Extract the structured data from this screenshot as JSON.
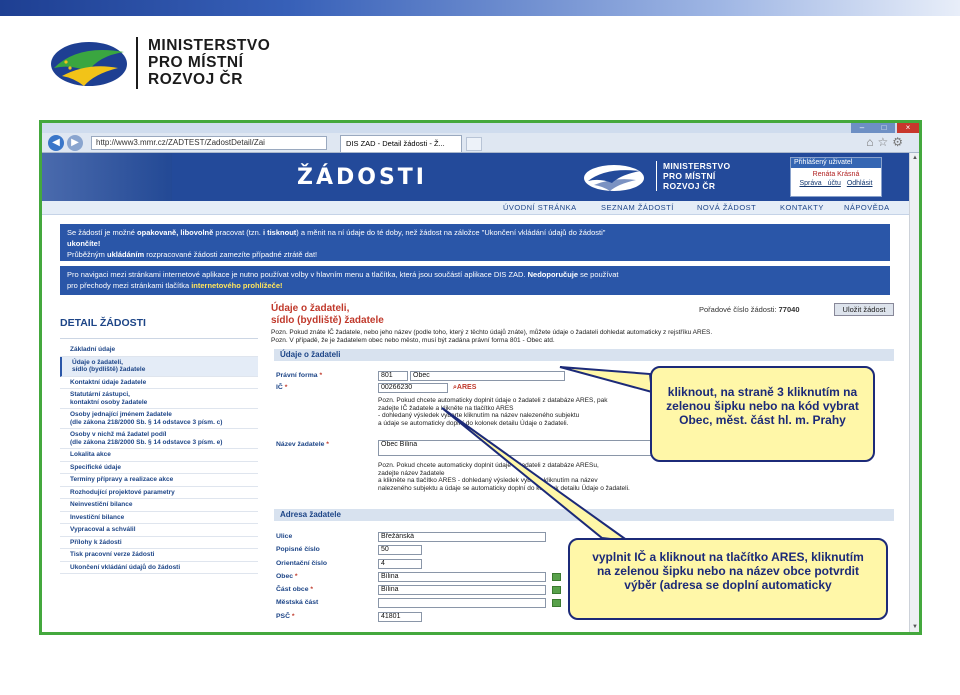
{
  "slide": {
    "ministry_lines": [
      "MINISTERSTVO",
      "PRO MÍSTNÍ",
      "ROZVOJ ČR"
    ],
    "brand_colors": {
      "blue": "#1e3f92",
      "green": "#3aa640",
      "yellow": "#f2c318",
      "frame": "#44a83d"
    }
  },
  "browser": {
    "url": "http://www3.mmr.cz/ZADTEST/ZadostDetail/Zai",
    "tab_title": "DIS ZAD - Detail žádosti - Ž..."
  },
  "header": {
    "title": "ŽÁDOSTI",
    "ministry_lines": [
      "MINISTERSTVO",
      "PRO MÍSTNÍ",
      "ROZVOJ ČR"
    ],
    "user": {
      "heading": "Přihlášený uživatel",
      "name": "Renáta Krásná",
      "link_account": "Správa účtu",
      "link_logout": "Odhlásit"
    }
  },
  "menu": [
    "ÚVODNÍ STRÁNKA",
    "SEZNAM ŽÁDOSTÍ",
    "NOVÁ ŽÁDOST",
    "KONTAKTY",
    "NÁPOVĚDA"
  ],
  "info1": {
    "l1a": "Se žádostí je možné ",
    "l1b": "opakovaně, libovolně",
    "l1c": " pracovat (tzn. ",
    "l1d": "i tisknout",
    "l1e": ") a měnit na ní údaje do té doby, než žádost na záložce \"Ukončení vkládání údajů do žádosti\"",
    "l2": "ukončíte!",
    "l3a": "Průběžným ",
    "l3b": "ukládáním",
    "l3c": " rozpracované žádosti zamezíte případné ztrátě dat!"
  },
  "info2": {
    "l1a": "Pro navigaci mezi stránkami internetové aplikace je nutno používat volby v hlavním menu a tlačítka, která jsou součástí aplikace DIS ZAD. ",
    "l1b": "Nedoporučuje",
    "l1c": " se používat",
    "l2a": "pro přechody mezi stránkami tlačítka ",
    "l2b": "internetového prohlížeče!"
  },
  "detail_title": "DETAIL ŽÁDOSTI",
  "sidebar": [
    "Základní údaje",
    "Údaje o žadateli,",
    "sídlo (bydliště) žadatele",
    "Kontaktní údaje žadatele",
    "Statutární zástupci,",
    "kontaktní osoby žadatele",
    "Osoby jednající jménem žadatele",
    "(dle zákona 218/2000 Sb. § 14 odstavce 3 písm. c)",
    "Osoby v nichž má žadatel podíl",
    "(dle zákona 218/2000 Sb. § 14 odstavce 3 písm. e)",
    "Lokalita akce",
    "Specifické údaje",
    "Termíny přípravy a realizace akce",
    "Rozhodující projektové parametry",
    "Neinvestiční bilance",
    "Investiční bilance",
    "Vypracoval a schválil",
    "Přílohy k žádosti",
    "Tisk pracovní verze žádosti",
    "Ukončení vkládání údajů do žádosti"
  ],
  "main": {
    "title1": "Údaje o žadateli,",
    "title2": "sídlo (bydliště) žadatele",
    "poradi_label": "Pořadové číslo žádosti: ",
    "poradi_value": "77040",
    "save_button": "Uložit žádost",
    "pozn1": "Pozn. Pokud znáte IČ žadatele, nebo jeho název (podle toho, který z těchto údajů znáte), můžete údaje o žadateli dohledat automaticky z rejstříku ARES.",
    "pozn2": "Pozn. V případě, že je žadatelem obec nebo město, musí být zadána právní forma 801 - Obec atd.",
    "section1": "Údaje o žadateli",
    "pravni_forma_label": "Právní forma",
    "pravni_forma_code": "801",
    "pravni_forma_name": "Obec",
    "ic_label": "IČ",
    "ic_value": "00266230",
    "ares_label": "ARES",
    "pozn3": [
      "Pozn. Pokud chcete automaticky doplnit údaje o žadateli z databáze ARES, pak",
      "zadejte IČ žadatele a klikněte na tlačítko ARES",
      "- dohledaný výsledek vyberte kliknutím na název nalezeného subjektu",
      "a údaje se automaticky doplní do kolonek detailu Údaje o žadateli."
    ],
    "nazev_label": "Název žadatele",
    "nazev_value": "Obec Bílina",
    "pozn4": [
      "Pozn. Pokud chcete automaticky doplnit údaje o žadateli z databáze ARESu,",
      "zadejte název žadatele",
      "a klikněte na tlačítko ARES - dohledaný výsledek vyberte kliknutím na název",
      "nalezeného subjektu a údaje se automaticky doplní do kolonek detailu Údaje o žadateli."
    ],
    "section2": "Adresa žadatele",
    "ulice_label": "Ulice",
    "ulice_value": "Břežánská",
    "popisne_label": "Popisné číslo",
    "popisne_value": "50",
    "orientacni_label": "Orientační číslo",
    "orientacni_value": "4",
    "obec_label": "Obec",
    "obec_value": "Bílina",
    "cast_label": "Část obce",
    "cast_value": "Bílina",
    "mestska_label": "Městská část",
    "mestska_value": "",
    "psc_label": "PSČ",
    "psc_value": "41801",
    "required_mark": "*"
  },
  "callouts": {
    "top": "kliknout, na straně 3 kliknutím na zelenou šipku nebo na kód vybrat Obec, měst. část hl. m. Prahy",
    "bottom": "vyplnit IČ a kliknout na tlačítko ARES, kliknutím na zelenou šipku nebo na název obce potvrdit výběr (adresa se doplní automaticky"
  }
}
